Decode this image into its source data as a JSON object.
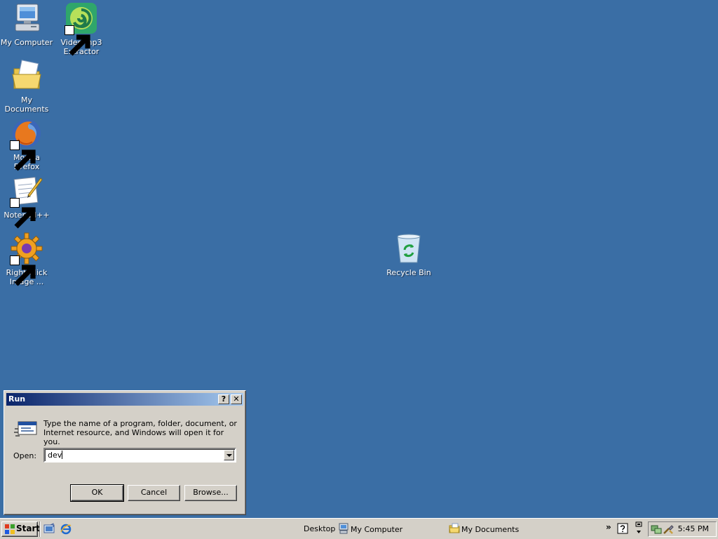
{
  "desktop": {
    "background_color": "#3a6ea5",
    "icons": [
      {
        "label": "My Computer",
        "icon": "my-computer-icon",
        "shortcut": false
      },
      {
        "label": "Video mp3 Extractor",
        "icon": "video-mp3-extractor-icon",
        "shortcut": true
      },
      {
        "label": "My Documents",
        "icon": "my-documents-icon",
        "shortcut": false
      },
      {
        "label": "Mozilla Firefox",
        "icon": "firefox-icon",
        "shortcut": true
      },
      {
        "label": "Notepad++",
        "icon": "notepad-plus-plus-icon",
        "shortcut": true
      },
      {
        "label": "Right Click Image ...",
        "icon": "right-click-image-icon",
        "shortcut": true
      },
      {
        "label": "Recycle Bin",
        "icon": "recycle-bin-icon",
        "shortcut": false
      }
    ]
  },
  "run_dialog": {
    "title": "Run",
    "help_button": "?",
    "close_button": "✕",
    "description": "Type the name of a program, folder, document, or Internet resource, and Windows will open it for you.",
    "open_label": "Open:",
    "open_value": "dev",
    "ok_label": "OK",
    "cancel_label": "Cancel",
    "browse_label": "Browse..."
  },
  "taskbar": {
    "start_label": "Start",
    "quick_launch": [
      "show-desktop-icon",
      "internet-explorer-icon"
    ],
    "desktop_toolbar_label": "Desktop",
    "items": [
      {
        "label": "My Computer",
        "icon": "my-computer-icon"
      },
      {
        "label": "My Documents",
        "icon": "my-documents-icon"
      }
    ],
    "overflow_chevron": "»",
    "clock": "5:45 PM"
  }
}
